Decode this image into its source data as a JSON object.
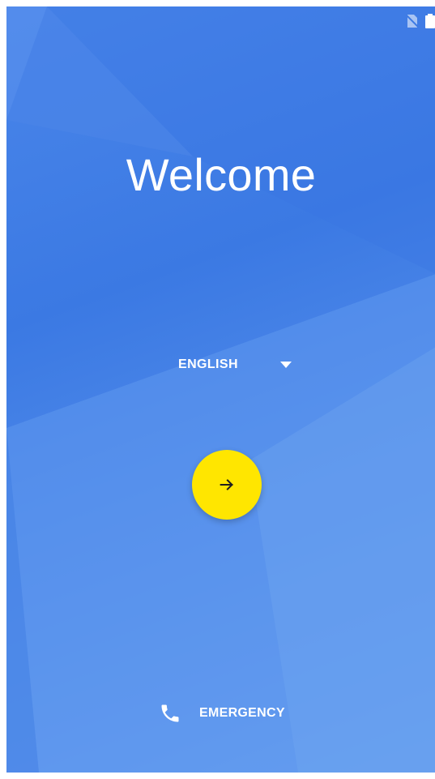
{
  "screen": {
    "title": "Welcome",
    "language": {
      "selected": "ENGLISH"
    },
    "emergency": {
      "label": "EMERGENCY"
    }
  },
  "icons": {
    "status_no_sim": "no-sim-icon",
    "status_battery": "battery-icon",
    "dropdown": "dropdown-triangle-icon",
    "next": "arrow-right-icon",
    "emergency": "phone-icon"
  },
  "colors": {
    "background": "#3b79e3",
    "background_light": "#6aa2f0",
    "accent_button": "#ffe600",
    "text": "#ffffff",
    "arrow": "#202020"
  }
}
